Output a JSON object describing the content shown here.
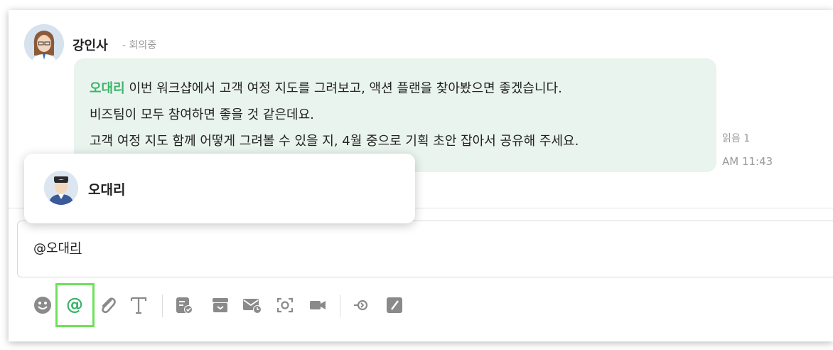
{
  "message": {
    "sender_name": "강인사",
    "sender_status": "- 회의중",
    "mention": "오대리",
    "line1_rest": " 이번 워크샵에서 고객 여정 지도를 그려보고, 액션 플랜을 찾아봤으면 좋겠습니다.",
    "line2": "비즈팀이 모두 참여하면 좋을 것 같은데요.",
    "line3": "고객 여정 지도 함께 어떻게 그려볼 수 있을 지, 4월 중으로 기획 초안 잡아서 공유해 주세요.",
    "read_count": "읽음 1",
    "time": "AM 11:43"
  },
  "mention_popup": {
    "name": "오대리"
  },
  "composer": {
    "text_prefix": "@오대",
    "text_composing": "리"
  },
  "toolbar": {
    "icons": [
      "emoji-icon",
      "mention-icon",
      "attach-icon",
      "text-format-icon",
      "task-icon",
      "archive-icon",
      "schedule-mail-icon",
      "capture-icon",
      "video-icon",
      "plugin-icon",
      "edit-icon"
    ],
    "highlighted": "mention-icon"
  },
  "colors": {
    "accent_green": "#3bb56a",
    "bubble_bg": "#eaf4ee",
    "highlight": "#6ee05a",
    "icon_gray": "#8a8a8a"
  }
}
